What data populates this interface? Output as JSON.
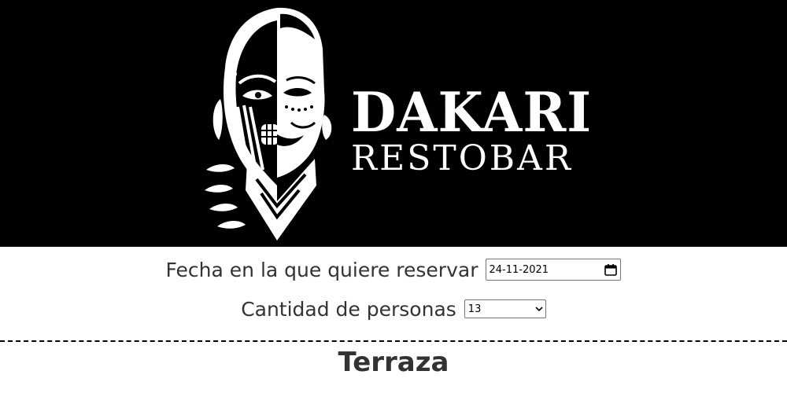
{
  "header": {
    "brand_name": "DAKARI",
    "brand_subtitle": "RESTOBAR",
    "logo_icon": "african-mask-face-icon"
  },
  "reservation_form": {
    "date_label": "Fecha en la que quiere reservar",
    "date_value": "24-11-2021",
    "people_label": "Cantidad de personas",
    "people_value": "13"
  },
  "section": {
    "title": "Terraza"
  },
  "colors": {
    "hero_background": "#000000",
    "hero_text": "#ffffff",
    "body_text": "#333333"
  }
}
